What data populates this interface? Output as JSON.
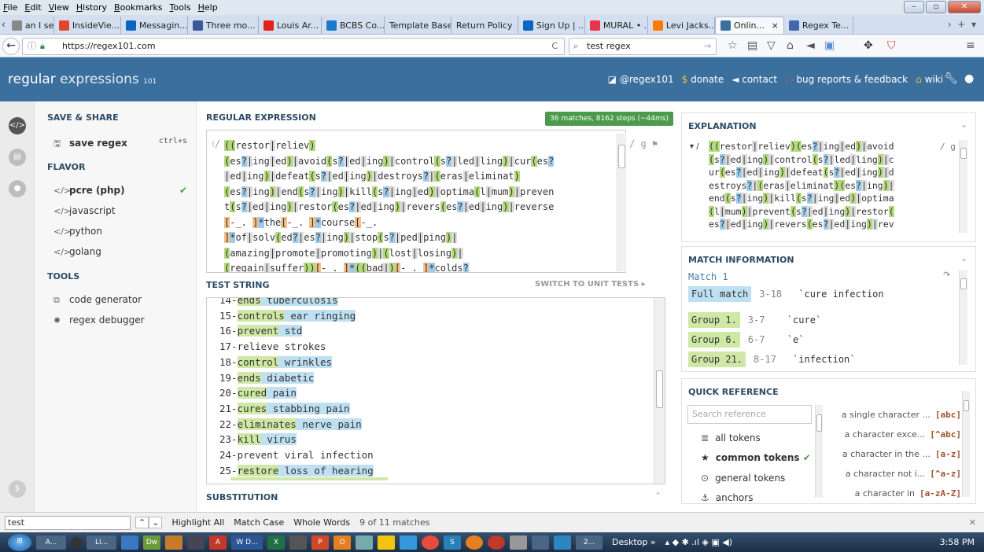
{
  "browser": {
    "menu": [
      "File",
      "Edit",
      "View",
      "History",
      "Bookmarks",
      "Tools",
      "Help"
    ],
    "tabs": [
      {
        "label": "an I set ...",
        "color": "#888888",
        "icon": "page-icon"
      },
      {
        "label": "InsideVie...",
        "color": "#e2462f",
        "icon": "insideview-icon"
      },
      {
        "label": "Messagin...",
        "color": "#0a66c2",
        "icon": "linkedin-icon"
      },
      {
        "label": "Three mo...",
        "color": "#3b5998",
        "icon": "medium-icon"
      },
      {
        "label": "Louis Ar...",
        "color": "#e62117",
        "icon": "youtube-icon"
      },
      {
        "label": "BCBS Co...",
        "color": "#1b7ac9",
        "icon": "bcbs-icon"
      },
      {
        "label": "Template Base",
        "color": "",
        "icon": ""
      },
      {
        "label": "Return Policy",
        "color": "",
        "icon": ""
      },
      {
        "label": "Sign Up | ...",
        "color": "#0a66c2",
        "icon": "linkedin-icon"
      },
      {
        "label": "MURAL • ...",
        "color": "#e8334a",
        "icon": "mural-icon"
      },
      {
        "label": "Levi Jacks...",
        "color": "#ff7a00",
        "icon": "bitbucket-icon"
      },
      {
        "label": "Onlin...",
        "color": "#3b6f9e",
        "icon": "regex101-icon",
        "active": true
      },
      {
        "label": "Regex Te...",
        "color": "#4466aa",
        "icon": "regexr-icon"
      }
    ],
    "url": "https://regex101.com",
    "search": "test regex"
  },
  "app": {
    "logo_light": "regular",
    "logo_bold": " expressions",
    "logo_version": "101",
    "header_links": [
      {
        "label": "@regex101",
        "icon": "twitter-icon"
      },
      {
        "label": "donate",
        "icon": "dollar-icon"
      },
      {
        "label": "contact",
        "icon": "send-icon"
      },
      {
        "label": "bug reports & feedback",
        "icon": "lifebuoy-icon"
      },
      {
        "label": "wiki",
        "icon": "bank-icon"
      }
    ]
  },
  "sidebar": {
    "save_share": "SAVE & SHARE",
    "save_regex": "save regex",
    "save_shortcut": "ctrl+s",
    "flavor": "FLAVOR",
    "flavors": [
      "pcre (php)",
      "javascript",
      "python",
      "golang"
    ],
    "tools": "TOOLS",
    "tool_items": [
      "code generator",
      "regex debugger"
    ]
  },
  "regex": {
    "title": "REGULAR EXPRESSION",
    "badge": "36 matches, 8162 steps (~44ms)",
    "delimiter": "/",
    "flags": "/ g",
    "lines": [
      "((restor|reliev)",
      "(es?|ing|ed)|avoid(s?|ed|ing)|control(s?|led|ling)|cur(es?",
      "|ed|ing)|defeat(s?|ed|ing)|destroys?|(eras|eliminat)",
      "(es?|ing)|end(s?|ing)|kill(s?|ing|ed)|optima(l|mum)|preven",
      "t(s?|ed|ing)|restor(es?|ed|ing)|revers(es?|ed|ing)|reverse",
      "[-_. ]*the[-_. ]*course[-_.",
      "]*of|solv(ed?|es?|ing)|stop(s?|ped|ping)|",
      "(amazing|promote|promoting)|(lost|losing)|",
      "(regain|suffer))[-_. ]*((bad|)[-_. ]*colds?"
    ]
  },
  "test": {
    "title": "TEST STRING",
    "switch": "SWITCH TO UNIT TESTS ▸",
    "substitution": "SUBSTITUTION",
    "lines": [
      {
        "n": "14-",
        "a": "ends",
        "b": " tuberculosis"
      },
      {
        "n": "15-",
        "a": "controls",
        "b": " ear ringing"
      },
      {
        "n": "16-",
        "a": "prevent",
        "b": " std"
      },
      {
        "n": "17-",
        "a": "",
        "b": "relieve strokes"
      },
      {
        "n": "18-",
        "a": "control",
        "b": " wrinkles"
      },
      {
        "n": "19-",
        "a": "ends",
        "b": " diabetic"
      },
      {
        "n": "20-",
        "a": "cured",
        "b": " pain"
      },
      {
        "n": "21-",
        "a": "cures",
        "b": " stabbing pain"
      },
      {
        "n": "22-",
        "a": "eliminates",
        "b": " nerve pain"
      },
      {
        "n": "23-",
        "a": "kill",
        "b": " virus"
      },
      {
        "n": "24-",
        "a": "",
        "b": "prevent viral infection"
      },
      {
        "n": "25-",
        "a": "restore",
        "b": " loss of hearing"
      }
    ]
  },
  "explanation": {
    "title": "EXPLANATION",
    "delim": "/ g",
    "lines": [
      "((restor|reliev)(es?|ing|ed)|avoid",
      "(s?|ed|ing)|control(s?|led|ling)|c",
      "ur(es?|ed|ing)|defeat(s?|ed|ing)|d",
      "estroys?|(eras|eliminat)(es?|ing)|",
      "end(s?|ing)|kill(s?|ing|ed)|optima",
      "(l|mum)|prevent(s?|ed|ing)|restor(",
      "es?|ed|ing)|revers(es?|ed|ing)|rev"
    ]
  },
  "match_info": {
    "title": "MATCH INFORMATION",
    "match": "Match 1",
    "rows": [
      {
        "label": "Full match",
        "range": "3-18",
        "value": "`cure infection"
      },
      {
        "label": "Group 1.",
        "range": "3-7",
        "value": "`cure`"
      },
      {
        "label": "Group 6.",
        "range": "6-7",
        "value": "`e`"
      },
      {
        "label": "Group 21.",
        "range": "8-17",
        "value": "`infection`"
      }
    ]
  },
  "quick_ref": {
    "title": "QUICK REFERENCE",
    "placeholder": "Search reference",
    "categories": [
      "all tokens",
      "common tokens",
      "general tokens",
      "anchors"
    ],
    "items": [
      {
        "desc": "a single character ...",
        "tok": "[abc]"
      },
      {
        "desc": "a character exce...",
        "tok": "[^abc]"
      },
      {
        "desc": "a character in the ...",
        "tok": "[a-z]"
      },
      {
        "desc": "a character not i...",
        "tok": "[^a-z]"
      },
      {
        "desc": "a character in",
        "tok": "[a-zA-Z]"
      }
    ]
  },
  "findbar": {
    "value": "test",
    "highlight": "Highlight All",
    "match_case": "Match Case",
    "whole_words": "Whole Words",
    "status": "9 of 11 matches"
  },
  "taskbar": {
    "items": [
      "A...",
      "Li...",
      "W D...",
      "2...",
      "Desktop"
    ],
    "clock": "3:58 PM"
  }
}
